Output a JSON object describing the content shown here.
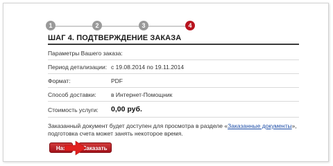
{
  "steps": [
    "1",
    "2",
    "3",
    "4"
  ],
  "title": "ШАГ 4. ПОДТВЕРЖДЕНИЕ ЗАКАЗА",
  "params_label": "Параметры Вашего заказа:",
  "rows": [
    {
      "label": "Период детализации:",
      "value": "с 19.08.2014 по 19.11.2014"
    },
    {
      "label": "Формат:",
      "value": "PDF"
    },
    {
      "label": "Способ доставки:",
      "value": "в Интернет-Помощник"
    },
    {
      "label": "Стоимость услуги:",
      "value": "0,00 руб."
    }
  ],
  "note": {
    "line1_prefix": "Заказанный документ будет доступен для просмотра в разделе «",
    "link": "Заказанные документы",
    "line1_suffix": "»,",
    "line2": "подготовка счета может занять некоторое время."
  },
  "buttons": {
    "back": "Наз",
    "order": "Заказать"
  },
  "colors": {
    "accent": "#b8141f",
    "inactive_step": "#9a9a9a",
    "arrow": "#e0201f"
  }
}
